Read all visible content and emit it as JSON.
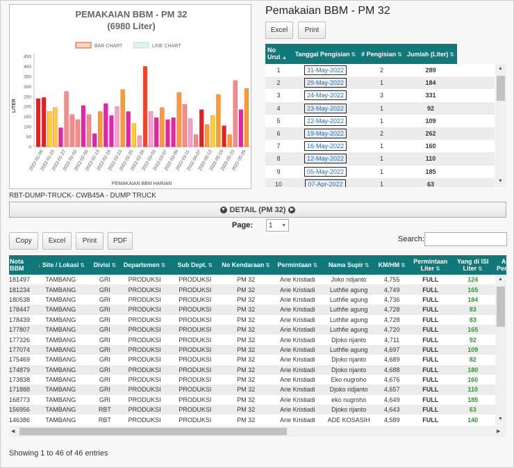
{
  "chart": {
    "title": "PEMAKAIAN BBM - PM 32",
    "subtitle": "(6980 Liter)",
    "legend": [
      "BAR CHART",
      "LINE CHART"
    ],
    "ylabel": "LITER",
    "xlabel": "PEMAKAIAN BBM HARIAN",
    "yticks": [
      "450",
      "400",
      "350",
      "300",
      "250",
      "200",
      "150",
      "100",
      "50",
      "0"
    ]
  },
  "chart_data": {
    "type": "bar",
    "title": "PEMAKAIAN BBM - PM 32",
    "subtitle": "(6980 Liter)",
    "xlabel": "PEMAKAIAN BBM HARIAN",
    "ylabel": "LITER",
    "ylim": [
      0,
      450
    ],
    "legend": [
      "BAR CHART",
      "LINE CHART"
    ],
    "legend_position": "top",
    "grid": false,
    "tick_labels": [
      "2022-01-08",
      "2022-01-23",
      "2022-01-27",
      "2022-02-02",
      "2022-02-05",
      "2022-02-13",
      "2022-02-19",
      "2022-02-23",
      "2022-02-25",
      "2022-02-28",
      "2022-03-03",
      "2022-03-07",
      "2022-03-09",
      "2022-03-11",
      "2022-04-07",
      "2022-05-12",
      "2022-05-19",
      "2022-05-23",
      "2022-05-29"
    ],
    "values": [
      240,
      245,
      175,
      195,
      95,
      275,
      160,
      135,
      205,
      160,
      65,
      175,
      215,
      155,
      200,
      285,
      175,
      115,
      55,
      400,
      175,
      145,
      195,
      135,
      145,
      270,
      210,
      140,
      60,
      185,
      110,
      155,
      260,
      105,
      60,
      330,
      185,
      290
    ],
    "colors": [
      "#e62020",
      "#e62020",
      "#ffd02a",
      "#ffd02a",
      "#e620b0",
      "#f78a8a",
      "#f78a8a",
      "#f78a8a",
      "#e620b0",
      "#f78a8a",
      "#e620b0",
      "#ff9a30",
      "#e620b0",
      "#e620b0",
      "#f7a0d0",
      "#ff9a30",
      "#e620b0",
      "#ffd02a",
      "#f7a0d0",
      "#ff4020",
      "#f7a0d0",
      "#e620b0",
      "#ff9a30",
      "#e620b0",
      "#e620b0",
      "#ff9a30",
      "#f78a8a",
      "#f7a0d0",
      "#f78a8a",
      "#e62020",
      "#ff9a30",
      "#ffd02a",
      "#ff9a30",
      "#e62020",
      "#ff9a30",
      "#f78a8a",
      "#e620b0",
      "#ff9a30"
    ]
  },
  "summary": {
    "title": "Pemakaian BBM - PM 32",
    "excel": "Excel",
    "print": "Print",
    "headers": [
      "No Urut",
      "Tanggal Pengisian",
      "# Pengisian",
      "Jumlah (Liter)"
    ],
    "rows": [
      [
        "1",
        "31-May-2022",
        "2",
        "289"
      ],
      [
        "2",
        "29-May-2022",
        "1",
        "184"
      ],
      [
        "3",
        "24-May-2022",
        "3",
        "331"
      ],
      [
        "4",
        "23-May-2022",
        "1",
        "92"
      ],
      [
        "5",
        "22-May-2022",
        "1",
        "109"
      ],
      [
        "6",
        "19-May-2022",
        "2",
        "262"
      ],
      [
        "7",
        "16-May-2022",
        "1",
        "160"
      ],
      [
        "8",
        "12-May-2022",
        "1",
        "110"
      ],
      [
        "9",
        "05-May-2022",
        "1",
        "185"
      ],
      [
        "10",
        "07-Apr-2022",
        "1",
        "63"
      ]
    ]
  },
  "caption": "RBT-DUMP-TRUCK- CWB45A - DUMP TRUCK",
  "detail": {
    "label": "DETAIL (PM 32)"
  },
  "pager": {
    "label": "Page:",
    "value": "1"
  },
  "toolbar": {
    "copy": "Copy",
    "excel": "Excel",
    "print": "Print",
    "pdf": "PDF"
  },
  "search": {
    "label": "Search:"
  },
  "detail_table": {
    "headers": [
      "Nota BBM",
      "Site / Lokasi",
      "Divisi",
      "Departemen",
      "Sub Dept.",
      "No Kendaraan",
      "Permintaan",
      "Nama Supir",
      "KM/HM",
      "Permintaan Liter",
      "Yang di ISI Liter",
      "Atas Persetu"
    ],
    "rows": [
      [
        "181497",
        "TAMBANG",
        "GRI",
        "PRODUKSI",
        "PRODUKSI",
        "PM 32",
        "Arie Kristiadi",
        "Joko ridjanto",
        "4,755",
        "FULL",
        "124",
        "A"
      ],
      [
        "181234",
        "TAMBANG",
        "GRI",
        "PRODUKSI",
        "PRODUKSI",
        "PM 32",
        "Arie Kristiadi",
        "Luthfie agung",
        "4,749",
        "FULL",
        "165",
        "A"
      ],
      [
        "180538",
        "TAMBANG",
        "GRI",
        "PRODUKSI",
        "PRODUKSI",
        "PM 32",
        "Arie Kristiadi",
        "Luthfie agung",
        "4,736",
        "FULL",
        "184",
        "A"
      ],
      [
        "178447",
        "TAMBANG",
        "GRI",
        "PRODUKSI",
        "PRODUKSI",
        "PM 32",
        "Arie Kristiadi",
        "Luthfie agung",
        "4,728",
        "FULL",
        "83",
        "A"
      ],
      [
        "178439",
        "TAMBANG",
        "GRI",
        "PRODUKSI",
        "PRODUKSI",
        "PM 32",
        "Arie Kristiadi",
        "Luthfie agung",
        "4,728",
        "FULL",
        "83",
        "A"
      ],
      [
        "177807",
        "TAMBANG",
        "GRI",
        "PRODUKSI",
        "PRODUKSI",
        "PM 32",
        "Arie Kristiadi",
        "Luthfie agung",
        "4,720",
        "FULL",
        "165",
        "A"
      ],
      [
        "177326",
        "TAMBANG",
        "GRI",
        "PRODUKSI",
        "PRODUKSI",
        "PM 32",
        "Arie Kristiadi",
        "Djoko rijanto",
        "4,711",
        "FULL",
        "92",
        "A"
      ],
      [
        "177074",
        "TAMBANG",
        "GRI",
        "PRODUKSI",
        "PRODUKSI",
        "PM 32",
        "Arie Kristiadi",
        "Luthfie agung",
        "4,697",
        "FULL",
        "109",
        "A"
      ],
      [
        "175469",
        "TAMBANG",
        "GRI",
        "PRODUKSI",
        "PRODUKSI",
        "PM 32",
        "Arie Kristiadi",
        "Djoko rijanto",
        "4,689",
        "FULL",
        "82",
        "A"
      ],
      [
        "174879",
        "TAMBANG",
        "GRI",
        "PRODUKSI",
        "PRODUKSI",
        "PM 32",
        "Arie Kristiadi",
        "Djoko rijanto",
        "4,688",
        "FULL",
        "180",
        "A"
      ],
      [
        "173838",
        "TAMBANG",
        "GRI",
        "PRODUKSI",
        "PRODUKSI",
        "PM 32",
        "Arie Kristiadi",
        "Eko nugroho",
        "4,676",
        "FULL",
        "160",
        "A"
      ],
      [
        "171888",
        "TAMBANG",
        "GRI",
        "PRODUKSI",
        "PRODUKSI",
        "PM 32",
        "Arie Kristiadi",
        "Djoko ridjanto",
        "4,657",
        "FULL",
        "110",
        "A"
      ],
      [
        "168773",
        "TAMBANG",
        "GRI",
        "PRODUKSI",
        "PRODUKSI",
        "PM 32",
        "Arie Kristiadi",
        "eko nugroho",
        "4,649",
        "FULL",
        "185",
        "A"
      ],
      [
        "156956",
        "TAMBANG",
        "RBT",
        "PRODUKSI",
        "PRODUKSI",
        "PM 32",
        "Arie Kristiadi",
        "Djoko rijanto",
        "4,643",
        "FULL",
        "63",
        "A"
      ],
      [
        "146386",
        "TAMBANG",
        "RBT",
        "PRODUKSI",
        "PRODUKSI",
        "PM 32",
        "Arie Kristiadi",
        "ADE KOSASIH",
        "4,589",
        "FULL",
        "140",
        "A"
      ]
    ]
  },
  "footer": "Showing 1 to 46 of 46 entries"
}
